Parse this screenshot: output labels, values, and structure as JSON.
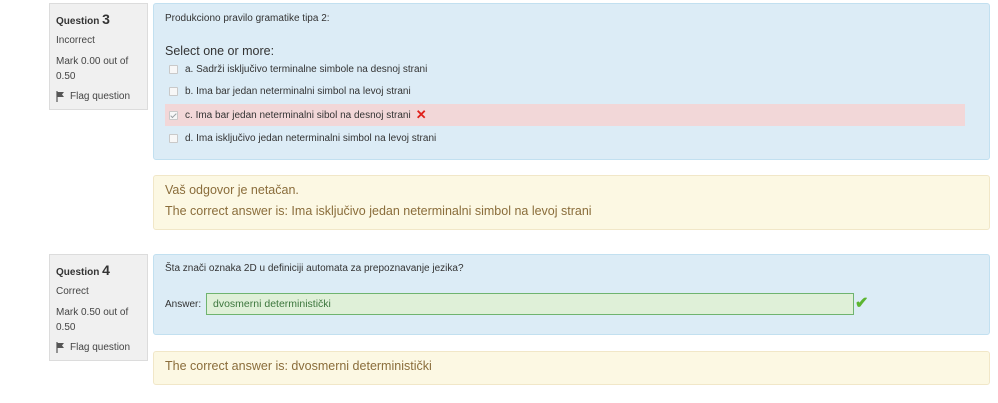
{
  "questions": [
    {
      "label": "Question",
      "number": "3",
      "state": "Incorrect",
      "mark_line1": "Mark 0.00 out of",
      "mark_line2": "0.50",
      "flag_label": "Flag question",
      "text": "Produkciono pravilo gramatike tipa 2:",
      "prompt": "Select one or more:",
      "options": [
        {
          "letter": "a.",
          "text": "Sadrži isključivo terminalne simbole na desnoj strani",
          "checked": false
        },
        {
          "letter": "b.",
          "text": "Ima bar jedan neterminalni simbol na levoj strani",
          "checked": false
        },
        {
          "letter": "c.",
          "text": "Ima bar jedan neterminalni sibol na desnoj strani",
          "checked": true,
          "result": "incorrect"
        },
        {
          "letter": "d.",
          "text": "Ima isključivo jedan neterminalni simbol na levoj strani",
          "checked": false
        }
      ],
      "feedback_line1": "Vaš odgovor je netačan.",
      "feedback_line2": "The correct answer is: Ima isključivo jedan neterminalni simbol na levoj strani"
    },
    {
      "label": "Question",
      "number": "4",
      "state": "Correct",
      "mark_line1": "Mark 0.50 out of",
      "mark_line2": "0.50",
      "flag_label": "Flag question",
      "text": "Šta znači oznaka 2D u definiciji automata za prepoznavanje jezika?",
      "answer_label": "Answer:",
      "answer_value": "dvosmerni deterministički",
      "feedback_line1": "The correct answer is: dvosmerni deterministički"
    }
  ],
  "colors": {
    "content_bg": "#dcecf6",
    "feedback_bg": "#fcf8e3",
    "incorrect_bg": "#f2d7d8",
    "correct_input_bg": "#dff0d8",
    "x_mark": "#e0201a",
    "check_mark": "#5cb531"
  },
  "icons": [
    "flag-icon",
    "x-mark-icon",
    "check-mark-icon"
  ]
}
